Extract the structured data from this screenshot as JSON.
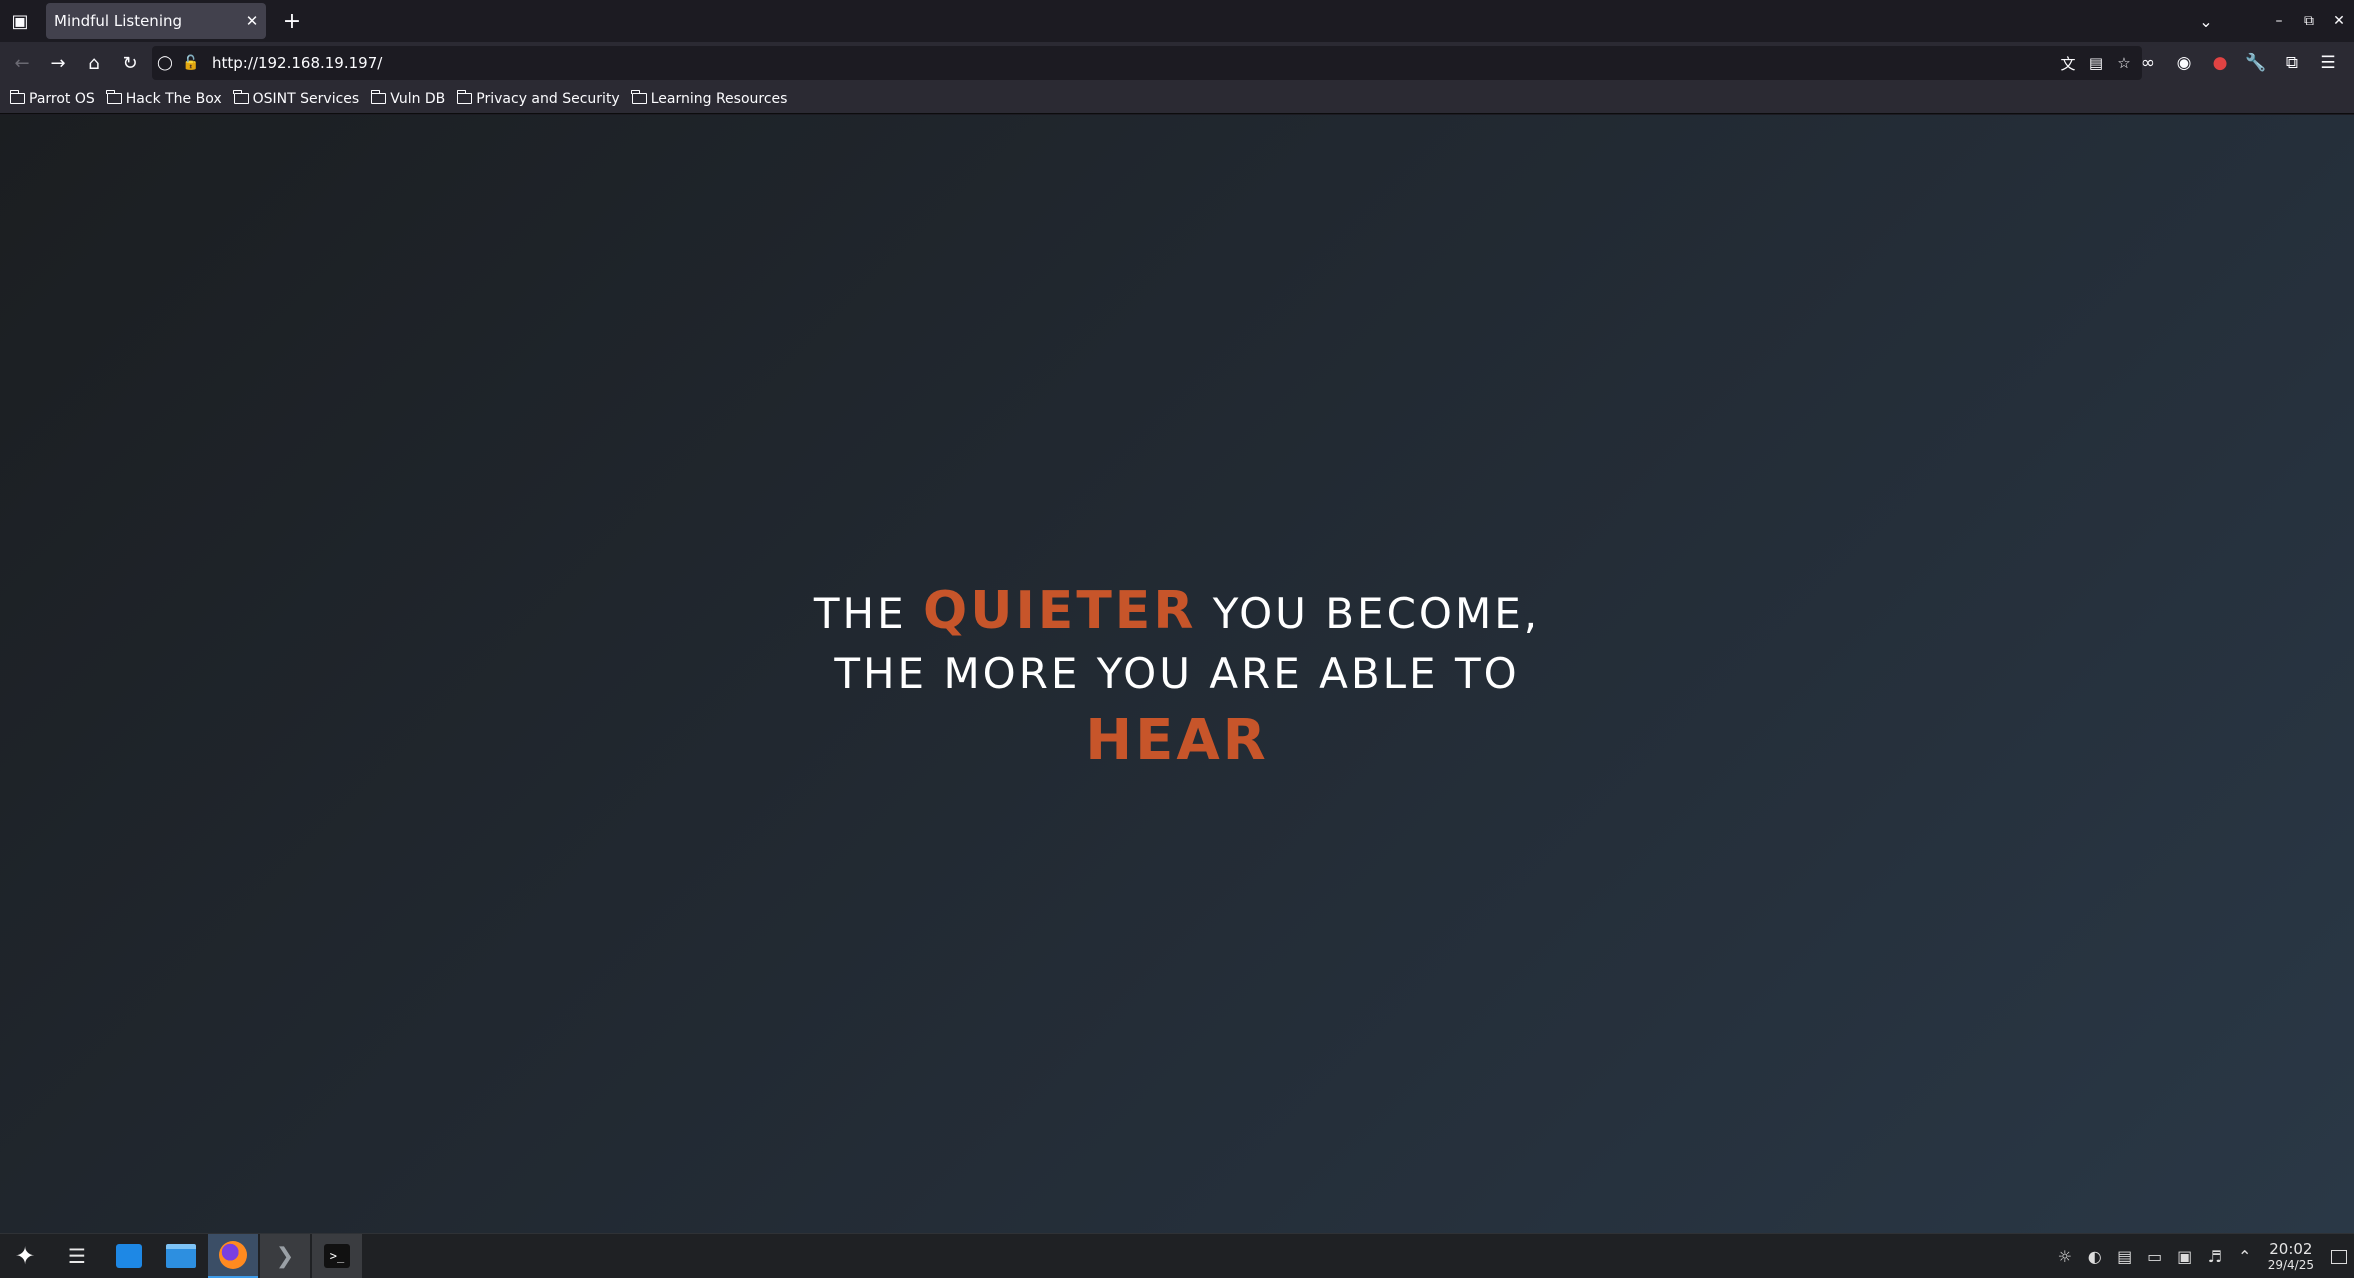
{
  "browser": {
    "tab": {
      "title": "Mindful Listening"
    },
    "url": "http://192.168.19.197/",
    "bookmarks": [
      "Parrot OS",
      "Hack The Box",
      "OSINT Services",
      "Vuln DB",
      "Privacy and Security",
      "Learning Resources"
    ],
    "icons": {
      "tab_overview": "tab-overview-icon",
      "close_tab": "close-icon",
      "new_tab": "plus-icon",
      "back": "back-arrow-icon",
      "forward": "forward-arrow-icon",
      "home": "home-icon",
      "reload": "reload-icon",
      "shield": "tracking-protection-shield-icon",
      "lock": "insecure-lock-icon",
      "translate": "translate-icon",
      "reader": "reader-view-icon",
      "bookmark_star": "star-icon",
      "extensions": [
        "incognito-glasses-icon",
        "account-icon",
        "ublock-icon",
        "wrench-icon",
        "puzzle-icon",
        "hamburger-menu-icon"
      ]
    }
  },
  "page": {
    "line1_pre": "THE",
    "line1_accent": "QUIETER",
    "line1_post": "YOU BECOME,",
    "line2": "THE MORE YOU ARE ABLE TO",
    "line3_accent": "HEAR",
    "accent_color": "#c7552a",
    "text_color": "#ffffff"
  },
  "taskbar": {
    "apps": [
      "application-menu-icon",
      "task-manager-icon",
      "software-store-icon",
      "file-manager-icon",
      "firefox-icon",
      "terminal-icon",
      "terminal-window-icon"
    ],
    "tray_icons": [
      "notifications-icon",
      "update-icon",
      "clipboard-icon",
      "usb-device-icon",
      "network-icon",
      "volume-icon",
      "expand-tray-icon"
    ],
    "clock": {
      "time": "20:02",
      "date": "29/4/25"
    }
  }
}
